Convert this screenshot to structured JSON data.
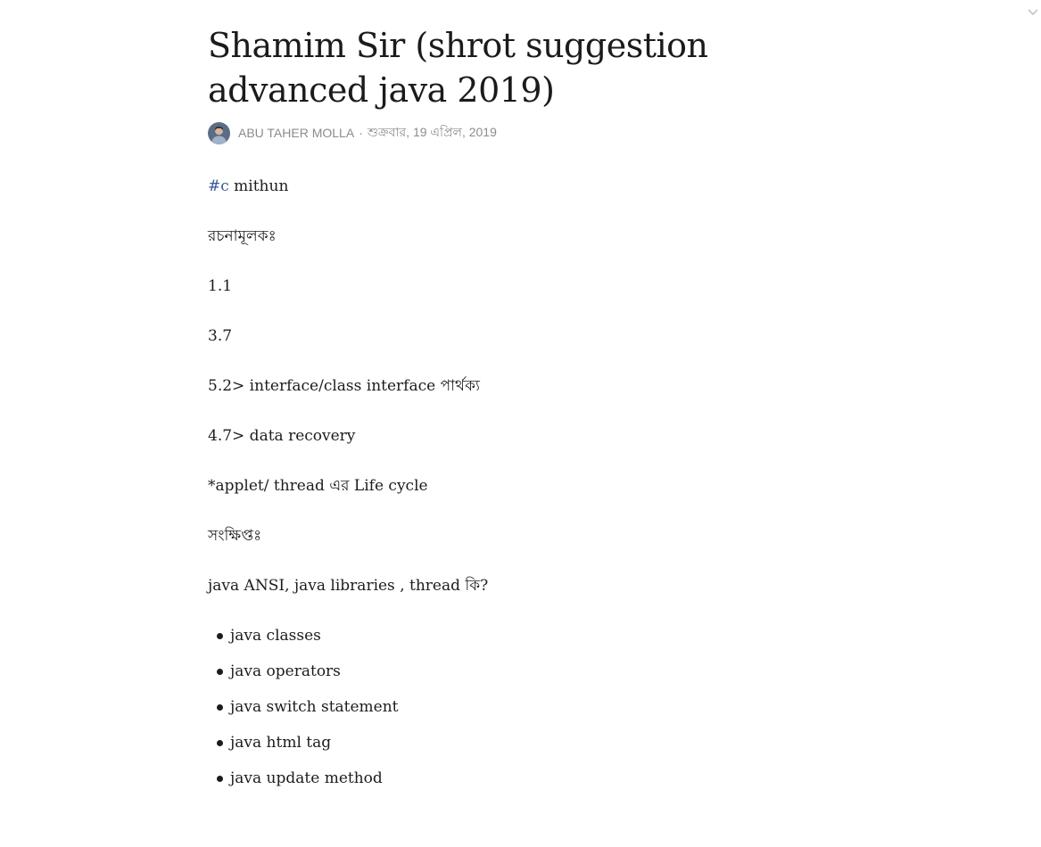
{
  "toolbar": {
    "collapse_icon": "chevron-down-icon"
  },
  "article": {
    "title_line1": "Shamim Sir (shrot suggestion",
    "title_line2": "advanced java 2019)",
    "author": "ABU TAHER MOLLA",
    "separator": "·",
    "date": "শুক্রবার, 19 এপ্রিল, 2019",
    "avatar_icon": "avatar-photo"
  },
  "content": {
    "hashtag": "#c",
    "hashtag_rest": " mithun",
    "p_rachana": "রচনামূলকঃ",
    "p_1_1": "1.1",
    "p_3_7": "3.7",
    "p_5_2": "5.2> interface/class interface পার্থক্য",
    "p_4_7": "4.7> data recovery",
    "p_applet": "*applet/ thread এর Life cycle",
    "p_sankhipta": "সংক্ষিপ্তঃ",
    "p_java_ansi": "java ANSI, java libraries  , thread কি?",
    "bullets": [
      "java classes",
      "java operators",
      "java switch statement",
      "java html tag",
      "java update method"
    ]
  },
  "colors": {
    "hashtag": "#385898",
    "meta_text": "#8c8c8c",
    "body_text": "#1c1c1c"
  }
}
